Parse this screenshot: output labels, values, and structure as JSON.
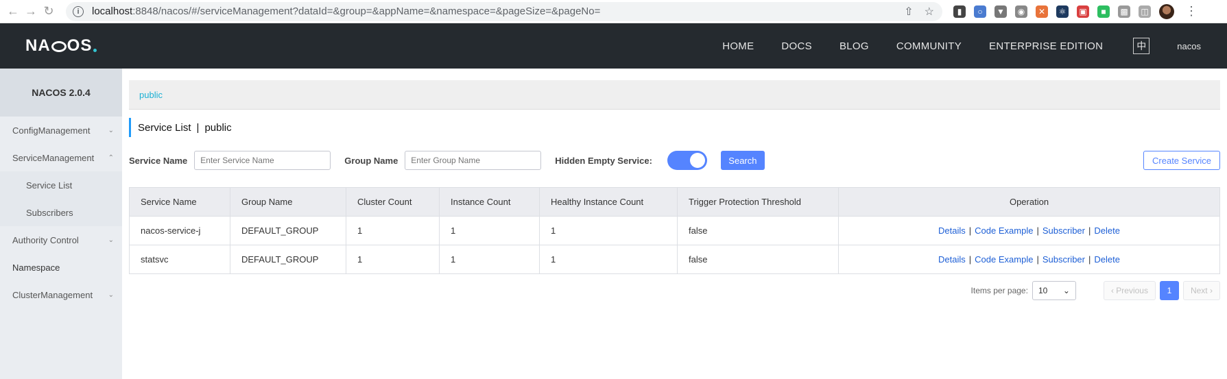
{
  "browser": {
    "url_host": "localhost",
    "url_rest": ":8848/nacos/#/serviceManagement?dataId=&group=&appName=&namespace=&pageSize=&pageNo="
  },
  "topnav": {
    "logo": "NACOS.",
    "links": [
      "HOME",
      "DOCS",
      "BLOG",
      "COMMUNITY",
      "ENTERPRISE EDITION"
    ],
    "lang": "中",
    "user": "nacos"
  },
  "sidebar": {
    "version": "NACOS 2.0.4",
    "items": [
      {
        "label": "ConfigManagement",
        "chevron": "down"
      },
      {
        "label": "ServiceManagement",
        "chevron": "up"
      },
      {
        "label": "Service List"
      },
      {
        "label": "Subscribers"
      },
      {
        "label": "Authority Control",
        "chevron": "down"
      },
      {
        "label": "Namespace"
      },
      {
        "label": "ClusterManagement",
        "chevron": "down"
      }
    ]
  },
  "namespace": {
    "current": "public"
  },
  "title": {
    "main": "Service List",
    "sep": "|",
    "ns": "public"
  },
  "filters": {
    "service_label": "Service Name",
    "service_placeholder": "Enter Service Name",
    "group_label": "Group Name",
    "group_placeholder": "Enter Group Name",
    "hidden_label": "Hidden Empty Service:",
    "hidden_on": true,
    "search_label": "Search",
    "create_label": "Create Service"
  },
  "table": {
    "headers": [
      "Service Name",
      "Group Name",
      "Cluster Count",
      "Instance Count",
      "Healthy Instance Count",
      "Trigger Protection Threshold",
      "Operation"
    ],
    "rows": [
      {
        "name": "nacos-service-j",
        "group": "DEFAULT_GROUP",
        "clusters": "1",
        "instances": "1",
        "healthy": "1",
        "threshold": "false"
      },
      {
        "name": "statsvc",
        "group": "DEFAULT_GROUP",
        "clusters": "1",
        "instances": "1",
        "healthy": "1",
        "threshold": "false"
      }
    ],
    "ops": {
      "details": "Details",
      "code": "Code Example",
      "subscriber": "Subscriber",
      "delete": "Delete",
      "sep": "|"
    }
  },
  "pager": {
    "ipp_label": "Items per page:",
    "ipp_value": "10",
    "prev": "Previous",
    "current": "1",
    "next": "Next"
  }
}
